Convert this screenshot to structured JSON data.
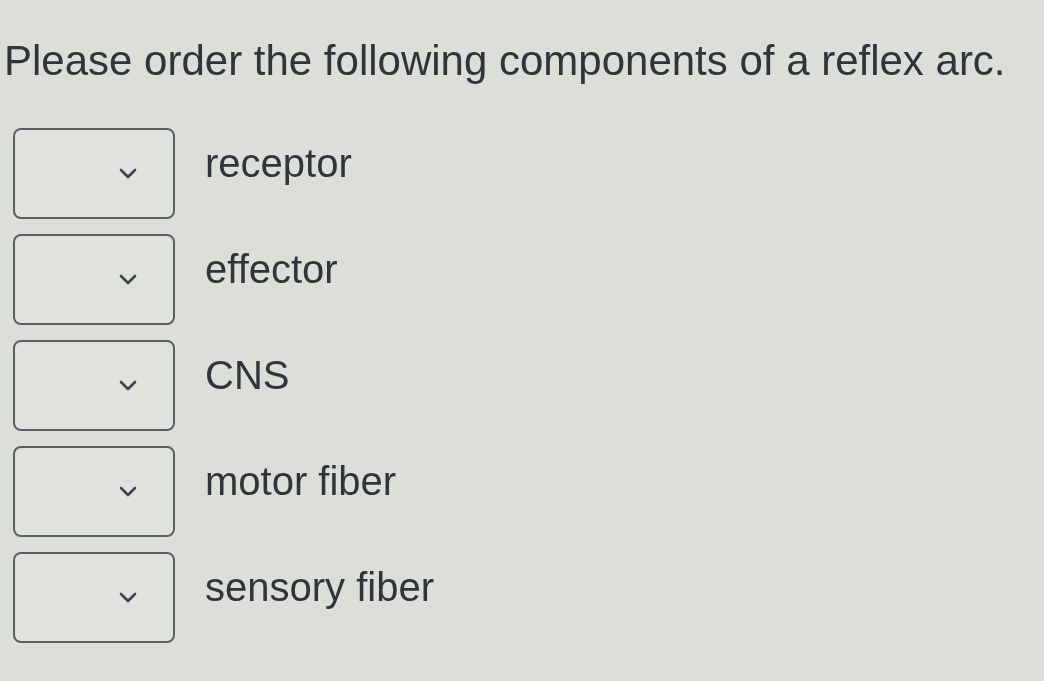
{
  "question": "Please order the following components of a reflex arc.",
  "items": [
    {
      "label": "receptor"
    },
    {
      "label": "effector"
    },
    {
      "label": "CNS"
    },
    {
      "label": "motor fiber"
    },
    {
      "label": "sensory fiber"
    }
  ]
}
